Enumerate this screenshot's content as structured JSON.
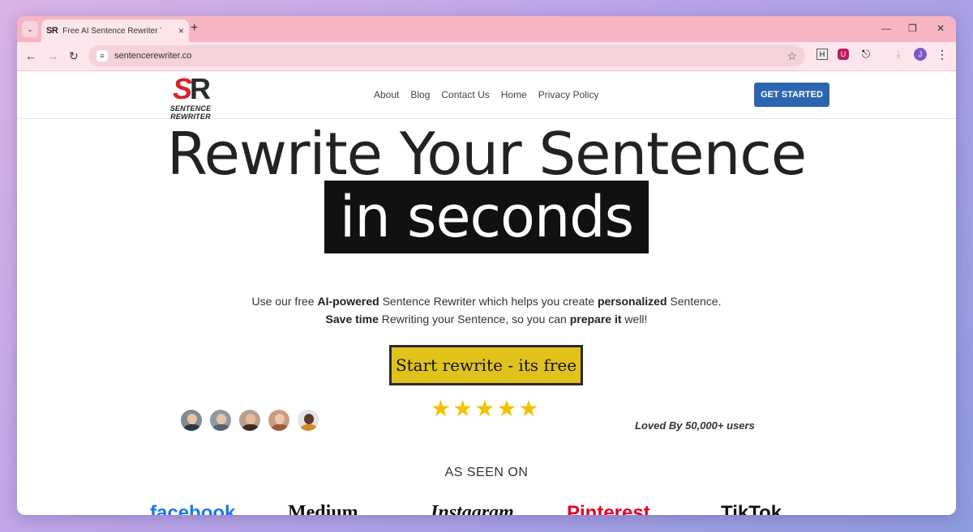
{
  "browser": {
    "tab_favicon": "SR",
    "tab_title": "Free AI Sentence Rewriter Tool",
    "tab_close": "×",
    "new_tab": "+",
    "url": "sentencerewriter.co",
    "avatar_initial": "J",
    "ext_h": "H"
  },
  "header": {
    "logo_mark_s": "S",
    "logo_mark_r": "R",
    "logo_tagline": "SENTENCE REWRITER",
    "nav": [
      "About",
      "Blog",
      "Contact Us",
      "Home",
      "Privacy Policy"
    ],
    "cta": "GET STARTED"
  },
  "hero": {
    "title": "Rewrite Your Sentence",
    "highlight": "in seconds",
    "sub_line1_a": "Use our free ",
    "sub_line1_b": "AI-powered",
    "sub_line1_c": " Sentence Rewriter which helps you create ",
    "sub_line1_d": "personalized",
    "sub_line1_e": " Sentence.",
    "sub_line2_a": "Save time",
    "sub_line2_b": " Rewriting your Sentence, so you can ",
    "sub_line2_c": "prepare it",
    "sub_line2_d": " well!",
    "start_button": "Start rewrite - its free",
    "rating_stars": 5,
    "loved": "Loved By 50,000+ users",
    "seen_on": "AS SEEN ON"
  },
  "brands": [
    "facebook",
    "Medium",
    "Instagram",
    "Pinterest",
    "TikTok"
  ],
  "colors": {
    "accent_blue": "#2c66b1",
    "start_yellow": "#e0c21a",
    "star_gold": "#f2c200",
    "logo_red": "#d4252b"
  }
}
